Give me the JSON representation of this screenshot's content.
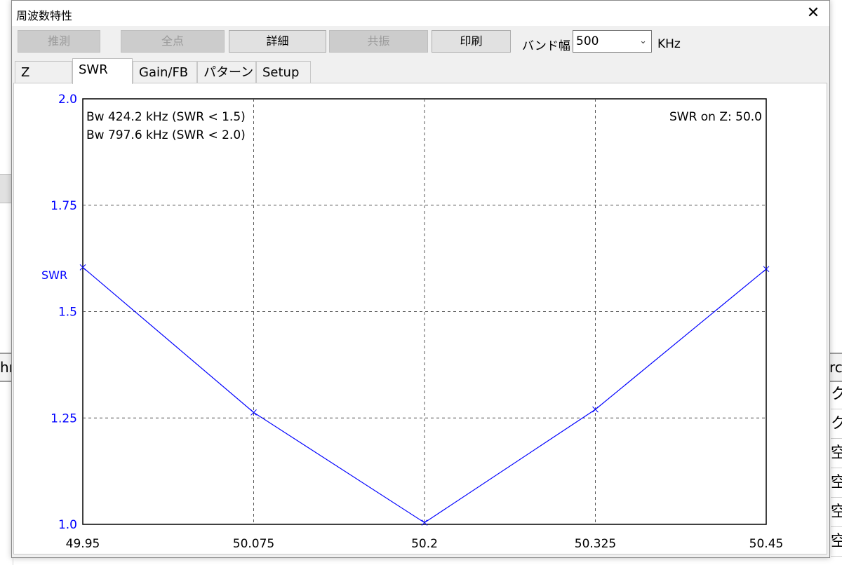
{
  "window": {
    "title": "周波数特性",
    "close_symbol": "✕"
  },
  "toolbar": {
    "buttons": [
      {
        "label": "推測",
        "enabled": false
      },
      {
        "label": "全点",
        "enabled": false
      },
      {
        "label": "詳細",
        "enabled": true
      },
      {
        "label": "共振",
        "enabled": false
      },
      {
        "label": "印刷",
        "enabled": true
      }
    ],
    "bandwidth_label": "バンド幅",
    "bandwidth_value": "500",
    "bandwidth_unit": "KHz"
  },
  "tabs": [
    {
      "label": "Z",
      "active": false
    },
    {
      "label": "SWR",
      "active": true
    },
    {
      "label": "Gain/FB",
      "active": false
    },
    {
      "label": "パターン",
      "active": false
    },
    {
      "label": "Setup",
      "active": false
    }
  ],
  "background": {
    "left_header_fragment": "hı",
    "right_header_fragment": "rc",
    "right_cells": [
      "ク",
      "ク",
      "空",
      "空",
      "空",
      "空"
    ]
  },
  "chart_data": {
    "type": "line",
    "title": "",
    "xlabel": "",
    "ylabel": "SWR",
    "xlim": [
      49.95,
      50.45
    ],
    "ylim": [
      1.0,
      2.0
    ],
    "x_ticks": [
      "49.95",
      "50.075",
      "50.2",
      "50.325",
      "50.45"
    ],
    "y_ticks": [
      "1.0",
      "1.25",
      "1.5",
      "1.75",
      "2.0"
    ],
    "grid": true,
    "annotations": [
      "Bw 424.2 kHz (SWR < 1.5)",
      "Bw 797.6 kHz (SWR < 2.0)",
      "SWR on Z: 50.0"
    ],
    "series": [
      {
        "color": "#0000ff",
        "x": [
          49.95,
          50.075,
          50.2,
          50.325,
          50.45
        ],
        "values": [
          1.604,
          1.263,
          1.004,
          1.27,
          1.6
        ]
      }
    ],
    "axis_text_color": "#0000ff"
  }
}
